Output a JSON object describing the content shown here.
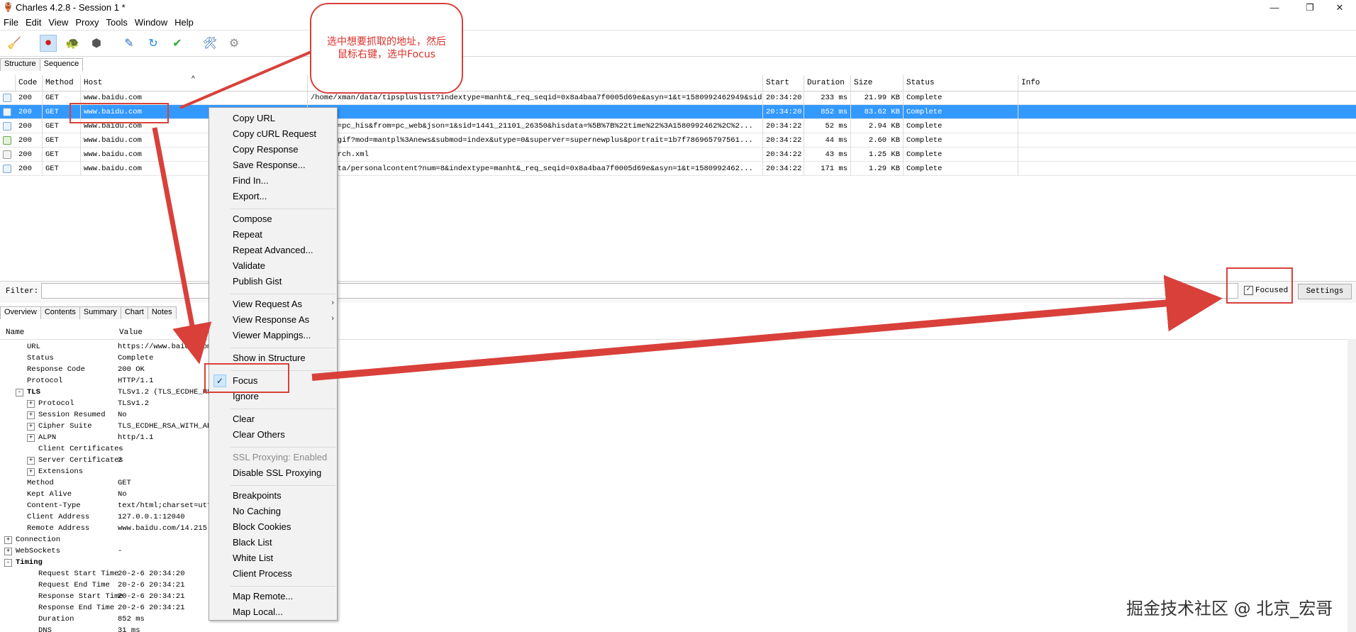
{
  "window": {
    "title": "Charles 4.2.8 - Session 1 *",
    "minimize": "—",
    "restore": "❐",
    "close": "✕"
  },
  "menubar": [
    "File",
    "Edit",
    "View",
    "Proxy",
    "Tools",
    "Window",
    "Help"
  ],
  "toolbar": {
    "icons": [
      "broom-icon",
      "record-icon",
      "turtle-icon",
      "stop-icon",
      "pen-icon",
      "refresh-icon",
      "check-icon",
      "tools-icon",
      "gear-icon"
    ],
    "glyphs": [
      "🧹",
      "⏺",
      "🐢",
      "⬢",
      "✎",
      "↻",
      "✔",
      "🛠",
      "⚙"
    ]
  },
  "top_tabs": [
    "Structure",
    "Sequence"
  ],
  "columns": [
    "Code",
    "Method",
    "Host",
    "",
    "Start",
    "Duration",
    "Size",
    "Status",
    "Info"
  ],
  "rows": [
    {
      "code": "200",
      "method": "GET",
      "host": "www.baidu.com",
      "path": "/home/xman/data/tipspluslist?indextype=manht&_req_seqid=0x8a4baa7f0005d69e&asyn=1&t=1580992462949&sid=...",
      "start": "20:34:20",
      "duration": "233 ms",
      "size": "21.99 KB",
      "status": "Complete",
      "info": ""
    },
    {
      "code": "200",
      "method": "GET",
      "host": "www.baidu.com",
      "path": "",
      "start": "20:34:20",
      "duration": "852 ms",
      "size": "83.62 KB",
      "status": "Complete",
      "info": ""
    },
    {
      "code": "200",
      "method": "GET",
      "host": "www.baidu.com",
      "path": "c?prod=pc_his&from=pc_web&json=1&sid=1441_21101_26350&hisdata=%5B%7B%22time%22%3A1580992462%2C%2...",
      "start": "20:34:22",
      "duration": "52 ms",
      "size": "2.94 KB",
      "status": "Complete",
      "info": ""
    },
    {
      "code": "200",
      "method": "GET",
      "host": "www.baidu.com",
      "path": "mit/v.gif?mod=mantpl%3Anews&submod=index&utype=0&superver=supernewplus&portrait=1b7f786965797561...",
      "start": "20:34:22",
      "duration": "44 ms",
      "size": "2.60 KB",
      "status": "Complete",
      "info": ""
    },
    {
      "code": "200",
      "method": "GET",
      "host": "www.baidu.com",
      "path": "nt-search.xml",
      "start": "20:34:22",
      "duration": "43 ms",
      "size": "1.25 KB",
      "status": "Complete",
      "info": ""
    },
    {
      "code": "200",
      "method": "GET",
      "host": "www.baidu.com",
      "path": "msg/data/personalcontent?num=8&indextype=manht&_req_seqid=0x8a4baa7f0005d69e&asyn=1&t=1580992462...",
      "start": "20:34:22",
      "duration": "171 ms",
      "size": "1.29 KB",
      "status": "Complete",
      "info": ""
    }
  ],
  "filter": {
    "label": "Filter:",
    "value": "",
    "focused_label": "Focused",
    "focused_checked": "✓",
    "settings_label": "Settings"
  },
  "bottom_tabs": [
    "Overview",
    "Contents",
    "Summary",
    "Chart",
    "Notes"
  ],
  "overview": {
    "name_header": "Name",
    "value_header": "Value",
    "rows": [
      {
        "name": "URL",
        "value": "https://www.baidu.com",
        "indent": 1,
        "bold": false,
        "exp": ""
      },
      {
        "name": "Status",
        "value": "Complete",
        "indent": 1,
        "bold": false,
        "exp": ""
      },
      {
        "name": "Response Code",
        "value": "200 OK",
        "indent": 1,
        "bold": false,
        "exp": ""
      },
      {
        "name": "Protocol",
        "value": "HTTP/1.1",
        "indent": 1,
        "bold": false,
        "exp": ""
      },
      {
        "name": "TLS",
        "value": "TLSv1.2 (TLS_ECDHE_RS",
        "indent": 1,
        "bold": true,
        "exp": "-"
      },
      {
        "name": "Protocol",
        "value": "TLSv1.2",
        "indent": 2,
        "bold": false,
        "exp": "+"
      },
      {
        "name": "Session Resumed",
        "value": "No",
        "indent": 2,
        "bold": false,
        "exp": "+"
      },
      {
        "name": "Cipher Suite",
        "value": "TLS_ECDHE_RSA_WITH_AE",
        "indent": 2,
        "bold": false,
        "exp": "+"
      },
      {
        "name": "ALPN",
        "value": "http/1.1",
        "indent": 2,
        "bold": false,
        "exp": "+"
      },
      {
        "name": "Client Certificates",
        "value": "-",
        "indent": 2,
        "bold": false,
        "exp": ""
      },
      {
        "name": "Server Certificates",
        "value": "2",
        "indent": 2,
        "bold": false,
        "exp": "+"
      },
      {
        "name": "Extensions",
        "value": "",
        "indent": 2,
        "bold": false,
        "exp": "+"
      },
      {
        "name": "Method",
        "value": "GET",
        "indent": 1,
        "bold": false,
        "exp": ""
      },
      {
        "name": "Kept Alive",
        "value": "No",
        "indent": 1,
        "bold": false,
        "exp": ""
      },
      {
        "name": "Content-Type",
        "value": "text/html;charset=utf",
        "indent": 1,
        "bold": false,
        "exp": ""
      },
      {
        "name": "Client Address",
        "value": "127.0.0.1:12040",
        "indent": 1,
        "bold": false,
        "exp": ""
      },
      {
        "name": "Remote Address",
        "value": "www.baidu.com/14.215.",
        "indent": 1,
        "bold": false,
        "exp": ""
      },
      {
        "name": "Connection",
        "value": "",
        "indent": 0,
        "bold": false,
        "exp": "+"
      },
      {
        "name": "WebSockets",
        "value": "-",
        "indent": 0,
        "bold": false,
        "exp": "+"
      },
      {
        "name": "Timing",
        "value": "",
        "indent": 0,
        "bold": true,
        "exp": "-"
      },
      {
        "name": "Request Start Time",
        "value": "20-2-6 20:34:20",
        "indent": 2,
        "bold": false,
        "exp": ""
      },
      {
        "name": "Request End Time",
        "value": "20-2-6 20:34:21",
        "indent": 2,
        "bold": false,
        "exp": ""
      },
      {
        "name": "Response Start Time",
        "value": "20-2-6 20:34:21",
        "indent": 2,
        "bold": false,
        "exp": ""
      },
      {
        "name": "Response End Time",
        "value": "20-2-6 20:34:21",
        "indent": 2,
        "bold": false,
        "exp": ""
      },
      {
        "name": "Duration",
        "value": "852 ms",
        "indent": 2,
        "bold": false,
        "exp": ""
      },
      {
        "name": "DNS",
        "value": "31 ms",
        "indent": 2,
        "bold": false,
        "exp": ""
      }
    ]
  },
  "context_menu": {
    "items": [
      {
        "label": "Copy URL",
        "disabled": false,
        "sub": false,
        "checked": false
      },
      {
        "label": "Copy cURL Request",
        "disabled": false,
        "sub": false,
        "checked": false
      },
      {
        "label": "Copy Response",
        "disabled": false,
        "sub": false,
        "checked": false
      },
      {
        "label": "Save Response...",
        "disabled": false,
        "sub": false,
        "checked": false
      },
      {
        "label": "Find In...",
        "disabled": false,
        "sub": false,
        "checked": false
      },
      {
        "label": "Export...",
        "disabled": false,
        "sub": false,
        "checked": false
      },
      {
        "sep": true
      },
      {
        "label": "Compose",
        "disabled": false,
        "sub": false,
        "checked": false
      },
      {
        "label": "Repeat",
        "disabled": false,
        "sub": false,
        "checked": false
      },
      {
        "label": "Repeat Advanced...",
        "disabled": false,
        "sub": false,
        "checked": false
      },
      {
        "label": "Validate",
        "disabled": false,
        "sub": false,
        "checked": false
      },
      {
        "label": "Publish Gist",
        "disabled": false,
        "sub": false,
        "checked": false
      },
      {
        "sep": true
      },
      {
        "label": "View Request As",
        "disabled": false,
        "sub": true,
        "checked": false
      },
      {
        "label": "View Response As",
        "disabled": false,
        "sub": true,
        "checked": false
      },
      {
        "label": "Viewer Mappings...",
        "disabled": false,
        "sub": false,
        "checked": false
      },
      {
        "sep": true
      },
      {
        "label": "Show in Structure",
        "disabled": false,
        "sub": false,
        "checked": false
      },
      {
        "sep": true
      },
      {
        "label": "Focus",
        "disabled": false,
        "sub": false,
        "checked": true
      },
      {
        "label": "Ignore",
        "disabled": false,
        "sub": false,
        "checked": false
      },
      {
        "sep": true
      },
      {
        "label": "Clear",
        "disabled": false,
        "sub": false,
        "checked": false
      },
      {
        "label": "Clear Others",
        "disabled": false,
        "sub": false,
        "checked": false
      },
      {
        "sep": true
      },
      {
        "label": "SSL Proxying: Enabled",
        "disabled": true,
        "sub": false,
        "checked": false
      },
      {
        "label": "Disable SSL Proxying",
        "disabled": false,
        "sub": false,
        "checked": false
      },
      {
        "sep": true
      },
      {
        "label": "Breakpoints",
        "disabled": false,
        "sub": false,
        "checked": false
      },
      {
        "label": "No Caching",
        "disabled": false,
        "sub": false,
        "checked": false
      },
      {
        "label": "Block Cookies",
        "disabled": false,
        "sub": false,
        "checked": false
      },
      {
        "label": "Black List",
        "disabled": false,
        "sub": false,
        "checked": false
      },
      {
        "label": "White List",
        "disabled": false,
        "sub": false,
        "checked": false
      },
      {
        "label": "Client Process",
        "disabled": false,
        "sub": false,
        "checked": false
      },
      {
        "sep": true
      },
      {
        "label": "Map Remote...",
        "disabled": false,
        "sub": false,
        "checked": false
      },
      {
        "label": "Map Local...",
        "disabled": false,
        "sub": false,
        "checked": false
      }
    ],
    "submenu_glyph": "›",
    "check_glyph": "✓"
  },
  "annotation": {
    "callout_line1": "选中想要抓取的地址，然后",
    "callout_line2": "鼠标右键，选中Focus"
  },
  "watermark": "掘金技术社区 @ 北京_宏哥",
  "colors": {
    "selection": "#3399ff",
    "annotation_red": "#d9403a"
  }
}
